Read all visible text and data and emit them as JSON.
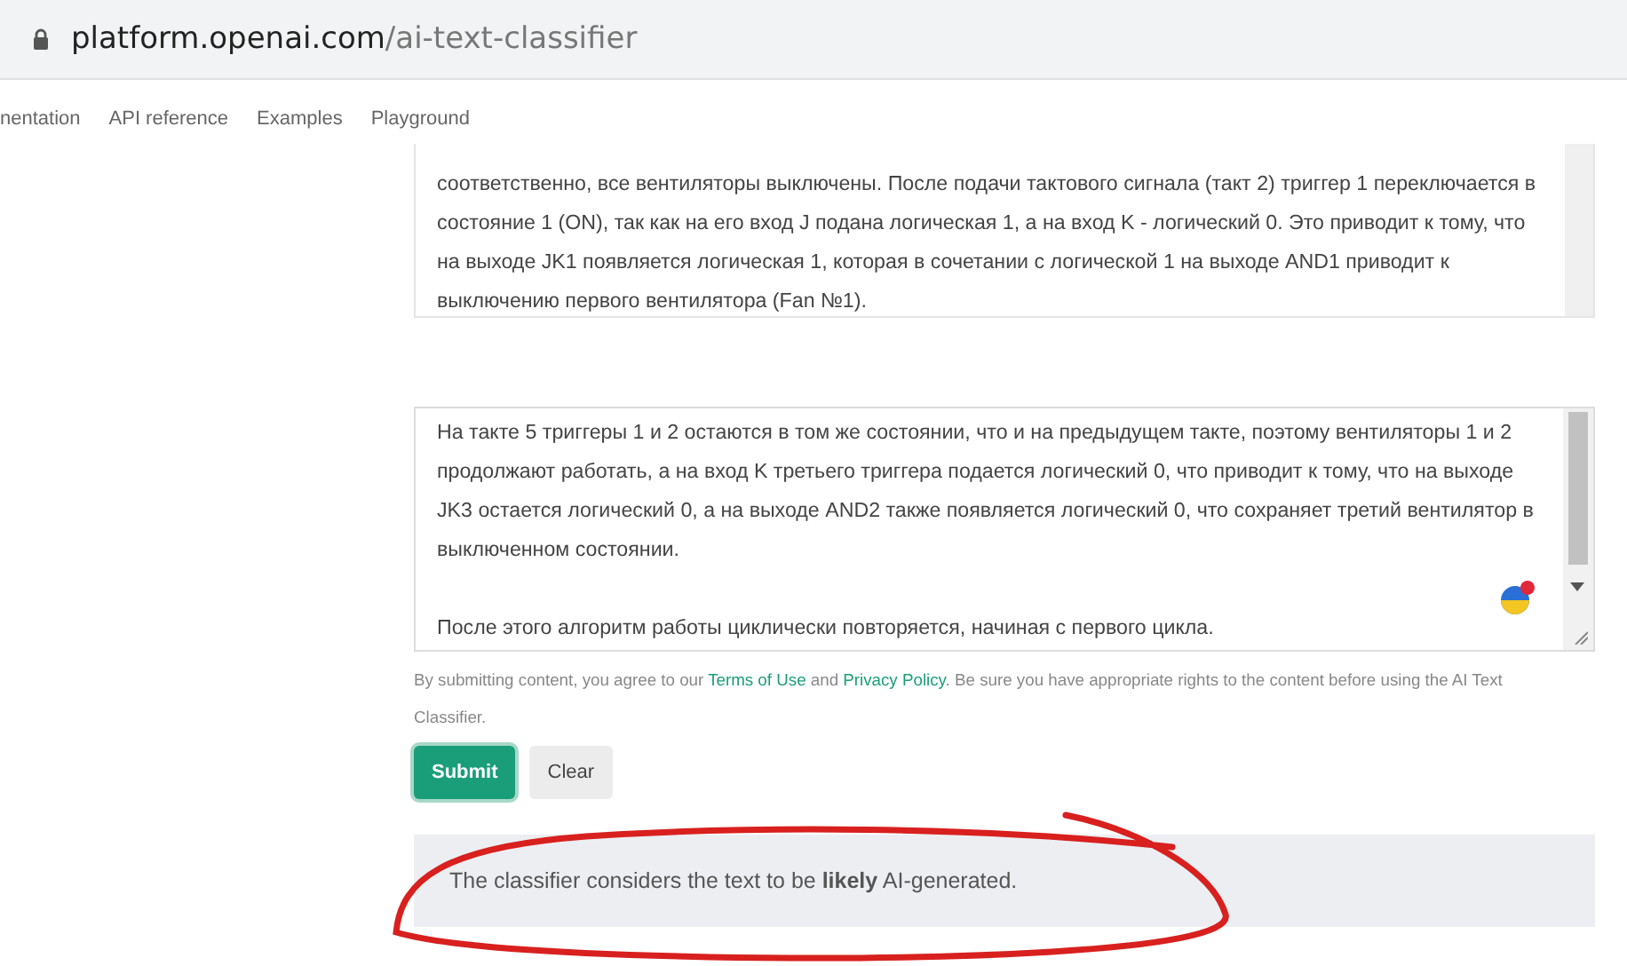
{
  "address_bar": {
    "host": "platform.openai.com",
    "path": "/ai-text-classifier"
  },
  "nav": {
    "items": [
      {
        "label": "nentation"
      },
      {
        "label": "API reference"
      },
      {
        "label": "Examples"
      },
      {
        "label": "Playground"
      }
    ]
  },
  "previous_text": {
    "paragraphs": [
      "соответственно, все вентиляторы выключены. После подачи тактового сигнала (такт 2) триггер 1 переключается в состояние 1 (ON), так как на его вход J подана логическая 1, а на вход K - логический 0. Это приводит к тому, что на выходе JK1 появляется логическая 1, которая в сочетании с логической 1 на выходе AND1 приводит к выключению первого вентилятора (Fan №1)."
    ]
  },
  "text_input": {
    "paragraphs": [
      "На такте 5 триггеры 1 и 2 остаются в том же состоянии, что и на предыдущем такте, поэтому вентиляторы 1 и 2 продолжают работать, а на вход K третьего триггера подается логический 0, что приводит к тому, что на выходе JK3 остается логический 0, а на выходе AND2 также появляется логический 0, что сохраняет третий вентилятор в выключенном состоянии.",
      "После этого алгоритм работы циклически повторяется, начиная с первого цикла."
    ]
  },
  "disclaimer": {
    "before": "By submitting content, you agree to our",
    "terms_link": "Terms of Use",
    "middle": "and",
    "privacy_link": "Privacy Policy",
    "after": ". Be sure you have appropriate rights to the content before using the AI Text Classifier."
  },
  "buttons": [
    {
      "label": "Submit",
      "kind": "primary"
    },
    {
      "label": "Clear",
      "kind": "secondary"
    }
  ],
  "result": {
    "text": "The classifier considers the text to be **likely** AI-generated."
  }
}
